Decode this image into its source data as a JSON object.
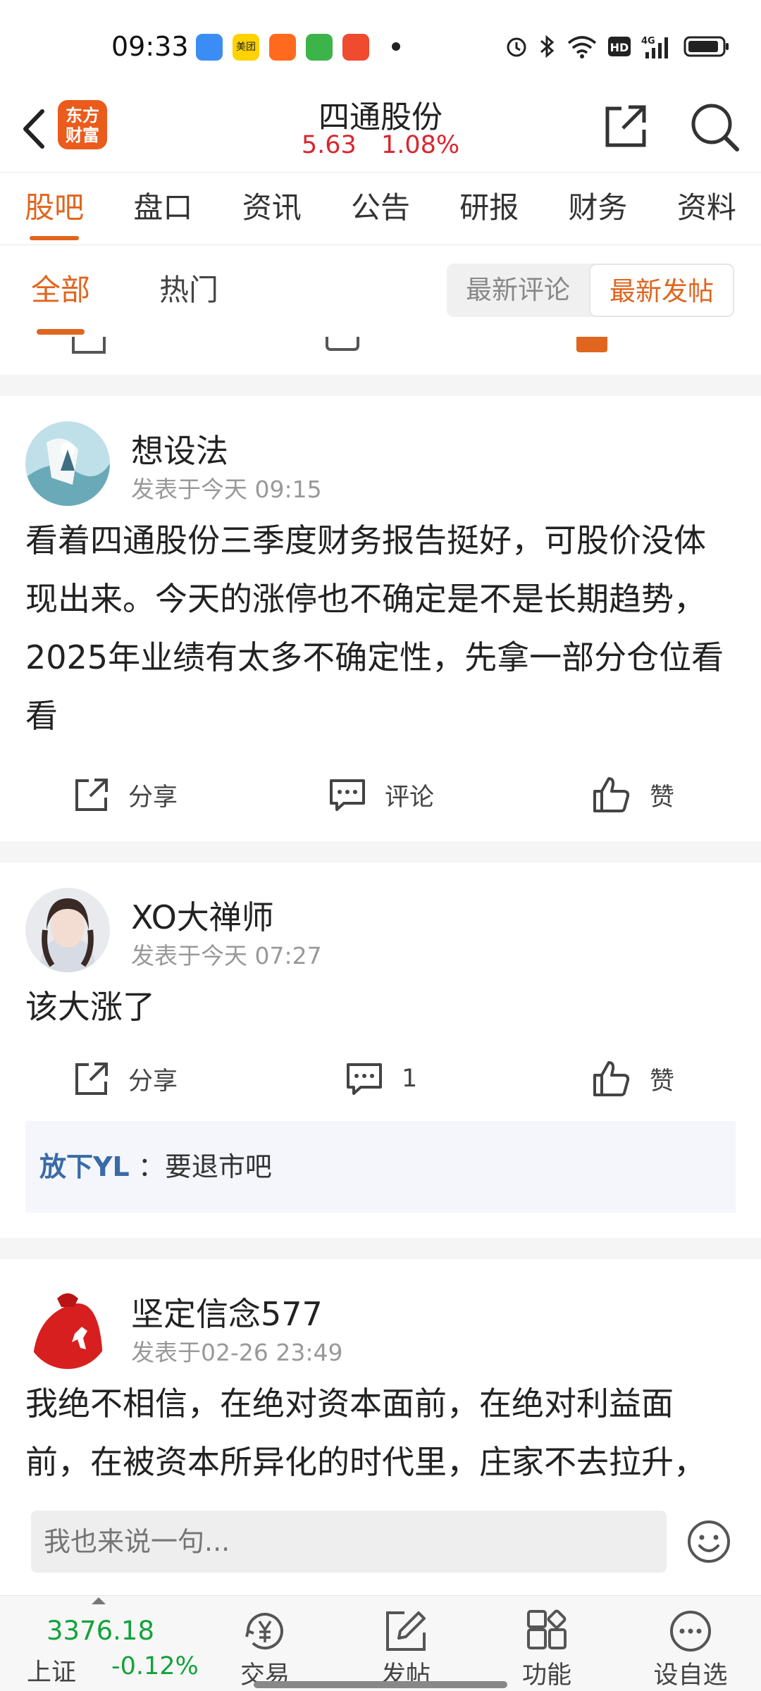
{
  "status_bar": {
    "time": "09:33",
    "app_icons": [
      "blue-app-icon",
      "meituan-icon",
      "kuaishou-icon",
      "green-message-icon",
      "video-play-icon"
    ],
    "system_icons": [
      "alarm-icon",
      "bluetooth-icon",
      "wifi-icon",
      "hd-icon",
      "4g-signal-icon",
      "battery-icon"
    ],
    "meituan_label": "美团"
  },
  "header": {
    "logo_text": "东方财富",
    "stock_name": "四通股份",
    "price": "5.63",
    "change_pct": "1.08%",
    "price_color": "#d9262e"
  },
  "main_tabs": [
    {
      "label": "股吧",
      "active": true
    },
    {
      "label": "盘口",
      "active": false
    },
    {
      "label": "资讯",
      "active": false
    },
    {
      "label": "公告",
      "active": false
    },
    {
      "label": "研报",
      "active": false
    },
    {
      "label": "财务",
      "active": false
    },
    {
      "label": "资料",
      "active": false
    }
  ],
  "sub_tabs": [
    {
      "label": "全部",
      "active": true
    },
    {
      "label": "热门",
      "active": false
    }
  ],
  "sort_options": [
    {
      "label": "最新评论",
      "active": false
    },
    {
      "label": "最新发帖",
      "active": true
    }
  ],
  "posts": [
    {
      "username": "想设法",
      "time": "发表于今天 09:15",
      "content": "看着四通股份三季度财务报告挺好，可股价没体现出来。今天的涨停也不确定是不是长期趋势，2025年业绩有太多不确定性，先拿一部分仓位看看",
      "share_label": "分享",
      "comment_label": "评论",
      "like_label": "赞"
    },
    {
      "username": "XO大禅师",
      "time": "发表于今天 07:27",
      "content": "该大涨了",
      "share_label": "分享",
      "comment_label": "1",
      "like_label": "赞",
      "reply_user": "放下YL",
      "reply_text": "：要退市吧"
    },
    {
      "username": "坚定信念577",
      "time": "发表于02-26 23:49",
      "content": "我绝不相信，在绝对资本面前，在绝对利益面前，在被资本所异化的时代里，庄家不去拉升，坦看大家..."
    }
  ],
  "comment_bar": {
    "placeholder": "我也来说一句..."
  },
  "bottom_nav": {
    "index_value": "3376.18",
    "index_name": "上证",
    "index_change": "-0.12%",
    "index_color": "#12a33a",
    "items": [
      {
        "label": "交易",
        "icon": "yuan-trade-icon"
      },
      {
        "label": "发帖",
        "icon": "compose-icon"
      },
      {
        "label": "功能",
        "icon": "grid-function-icon"
      },
      {
        "label": "设自选",
        "icon": "more-options-icon"
      }
    ]
  },
  "accent_color": "#e0651e"
}
